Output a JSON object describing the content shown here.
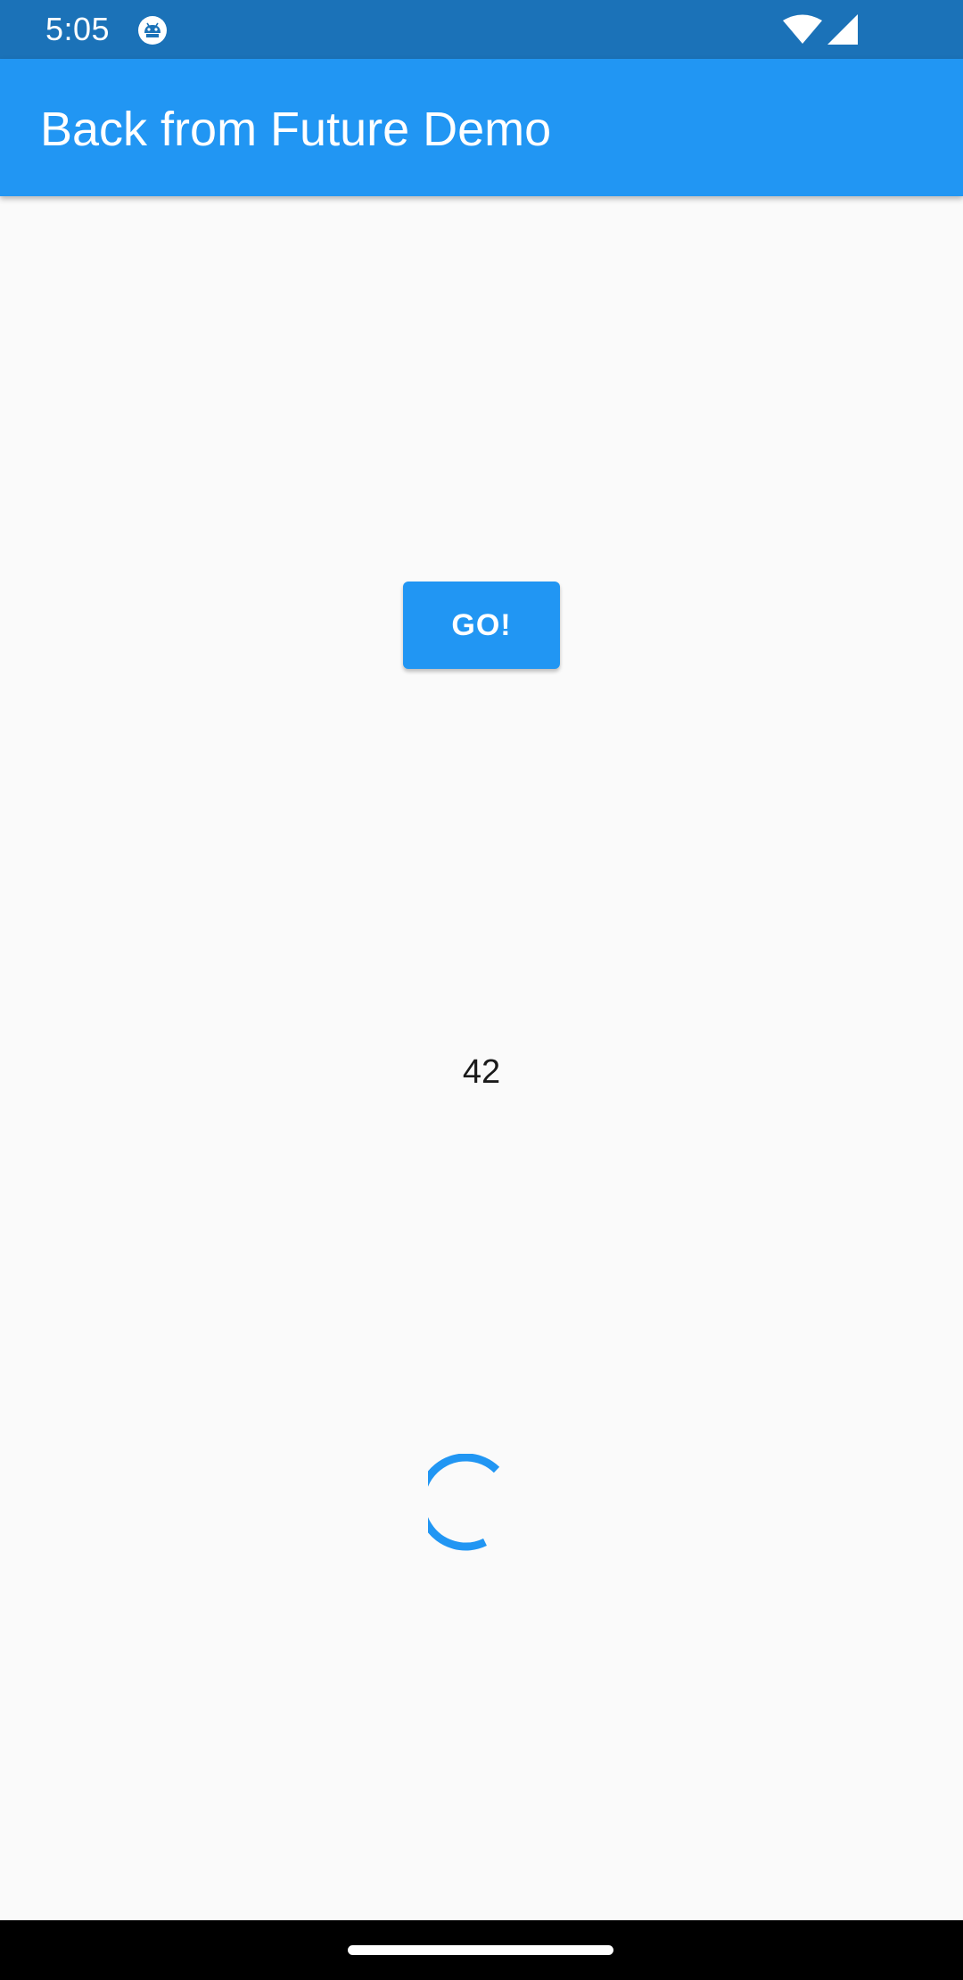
{
  "status_bar": {
    "time": "5:05",
    "app_icon": "android-debug-icon",
    "wifi_icon": "wifi-icon",
    "signal_icon": "cell-signal-icon",
    "background_color": "#1b72b8"
  },
  "app_bar": {
    "title": "Back from Future Demo",
    "background_color": "#2196f3"
  },
  "main": {
    "go_button_label": "GO!",
    "result_value": "42",
    "loading_indicator": "progress-spinner-icon",
    "accent_color": "#2196f3"
  },
  "navigation_bar": {
    "handle": "gesture-handle"
  }
}
